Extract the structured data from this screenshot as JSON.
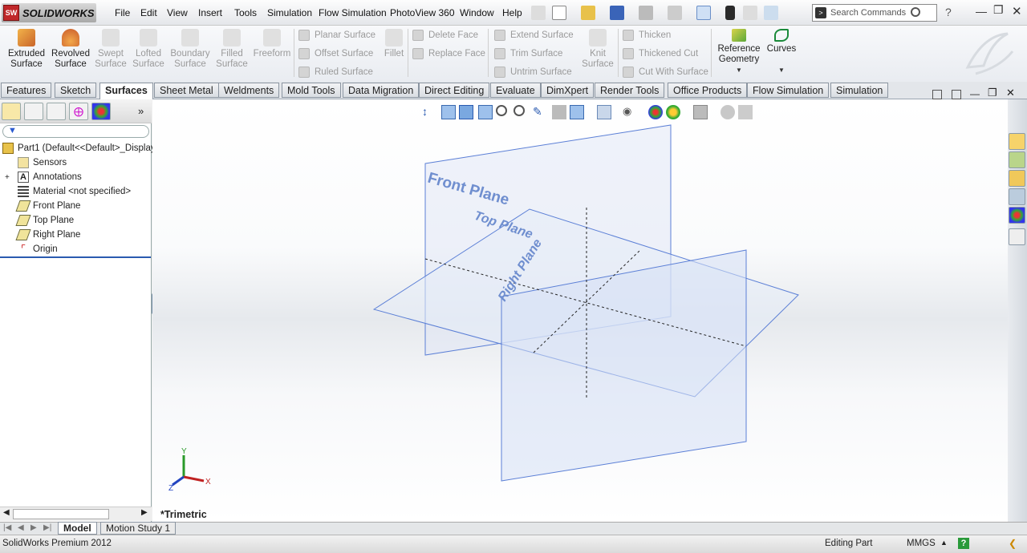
{
  "app": {
    "brand": "SOLIDWORKS",
    "logo_mark": "SW"
  },
  "menu": [
    "File",
    "Edit",
    "View",
    "Insert",
    "Tools",
    "Simulation",
    "Flow Simulation",
    "PhotoView 360",
    "Window",
    "Help"
  ],
  "search": {
    "placeholder": "Search Commands"
  },
  "ribbon": {
    "extruded": "Extruded Surface",
    "revolved": "Revolved Surface",
    "swept": "Swept Surface",
    "lofted": "Lofted Surface",
    "boundary": "Boundary Surface",
    "filled": "Filled Surface",
    "freeform": "Freeform",
    "planar": "Planar Surface",
    "offset": "Offset Surface",
    "ruled": "Ruled Surface",
    "fillet": "Fillet",
    "delete_face": "Delete Face",
    "replace_face": "Replace Face",
    "extend": "Extend Surface",
    "trim": "Trim Surface",
    "untrim": "Untrim Surface",
    "knit": "Knit Surface",
    "thicken": "Thicken",
    "thickened_cut": "Thickened Cut",
    "cut_with_surface": "Cut With Surface",
    "reference_geometry": "Reference Geometry",
    "curves": "Curves"
  },
  "tabs": [
    "Features",
    "Sketch",
    "Surfaces",
    "Sheet Metal",
    "Weldments",
    "Mold Tools",
    "Data Migration",
    "Direct Editing",
    "Evaluate",
    "DimXpert",
    "Render Tools",
    "Office Products",
    "Flow Simulation",
    "Simulation"
  ],
  "active_tab": "Surfaces",
  "tree": {
    "root": "Part1  (Default<<Default>_Display State 1>)",
    "items": [
      "Sensors",
      "Annotations",
      "Material <not specified>",
      "Front Plane",
      "Top Plane",
      "Right Plane",
      "Origin"
    ]
  },
  "viewport": {
    "view_name": "*Trimetric",
    "plane_labels": {
      "front": "Front Plane",
      "top": "Top Plane",
      "right": "Right Plane"
    },
    "axes": {
      "x": "X",
      "y": "Y",
      "z": "Z"
    }
  },
  "bottom_tabs": [
    "Model",
    "Motion Study 1"
  ],
  "status": {
    "product": "SolidWorks Premium 2012",
    "mode": "Editing Part",
    "units": "MMGS",
    "help": "?"
  },
  "colors": {
    "plane_stroke": "#5b7fd6",
    "plane_fill": "#e6ecf8",
    "plane_text": "#6f8ecf",
    "accent": "#c0282a"
  }
}
